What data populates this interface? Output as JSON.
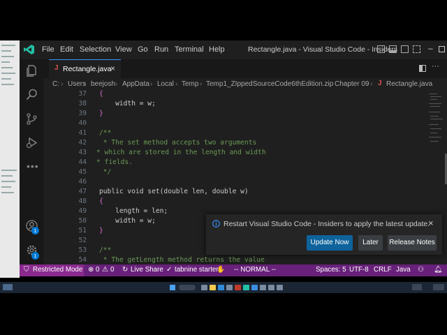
{
  "colors": {
    "accent": "#3794ff",
    "statusbar": "#68217a",
    "restricted": "#8a2a8f",
    "button_primary": "#0e639c",
    "editor_bg": "#1f1f1f"
  },
  "titlebar": {
    "menu": [
      "File",
      "Edit",
      "Selection",
      "View",
      "Go",
      "Run",
      "Terminal",
      "Help"
    ],
    "window_title": "Rectangle.java - Visual Studio Code - Insiders"
  },
  "activity_icons": [
    "files-icon",
    "search-icon",
    "source-control-icon",
    "run-debug-icon",
    "more-icon",
    "account-icon",
    "settings-gear-icon"
  ],
  "badges": {
    "account": "1",
    "settings": "1"
  },
  "tab": {
    "icon": "J",
    "label": "Rectangle.java",
    "close": "×"
  },
  "breadcrumb": {
    "items": [
      "C:",
      "Users",
      "beejosh",
      "AppData",
      "Local",
      "Temp",
      "Temp1_ZIppedSourceCode6thEdition.zip",
      "Chapter 09"
    ],
    "file_icon": "J",
    "file": "Rectangle.java"
  },
  "code": {
    "lines": [
      {
        "n": "37",
        "t": "{"
      },
      {
        "n": "38",
        "t": "    width = w;"
      },
      {
        "n": "39",
        "t": "}"
      },
      {
        "n": "40",
        "t": ""
      },
      {
        "n": "41",
        "t": "/**"
      },
      {
        "n": "42",
        "t": " * The set method accepts two arguments"
      },
      {
        "n": "43",
        "t": "* which are stored in the length and width"
      },
      {
        "n": "44",
        "t": "* fields."
      },
      {
        "n": "45",
        "t": " */"
      },
      {
        "n": "46",
        "t": ""
      },
      {
        "n": "47",
        "t": "public void set(double len, double w)"
      },
      {
        "n": "48",
        "t": "{"
      },
      {
        "n": "49",
        "t": "    length = len;"
      },
      {
        "n": "50",
        "t": "    width = w;"
      },
      {
        "n": "51",
        "t": "}"
      },
      {
        "n": "52",
        "t": ""
      },
      {
        "n": "53",
        "t": "/**"
      },
      {
        "n": "54",
        "t": " * The getLength method returns the value"
      }
    ]
  },
  "notification": {
    "message": "Restart Visual Studio Code - Insiders to apply the latest update.",
    "primary": "Update Now",
    "later": "Later",
    "notes": "Release Notes"
  },
  "statusbar": {
    "restricted": "Restricted Mode",
    "errors": "0",
    "warnings": "0",
    "live_share": "Live Share",
    "tabnine": "tabnine starter",
    "mode": "-- NORMAL --",
    "spaces": "Spaces: 5",
    "encoding": "UTF-8",
    "eol": "CRLF",
    "language": "Java"
  }
}
